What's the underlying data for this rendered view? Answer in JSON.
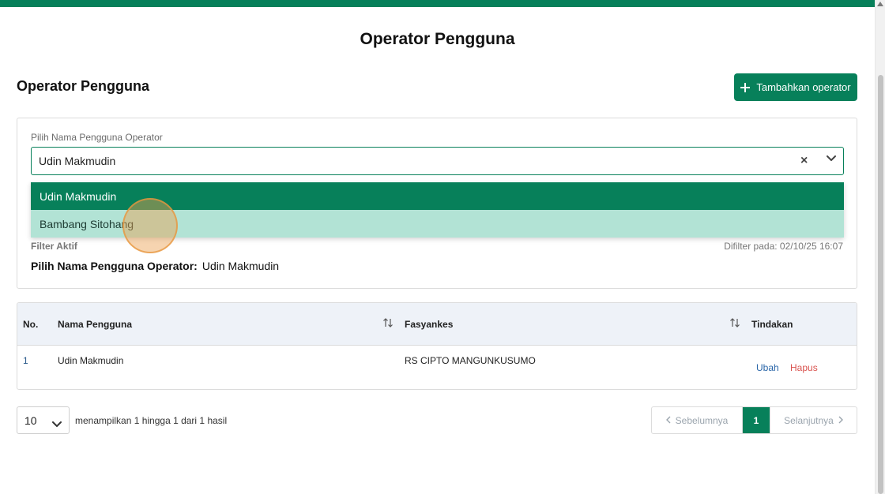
{
  "page": {
    "title": "Operator Pengguna"
  },
  "header": {
    "section_title": "Operator Pengguna",
    "add_button_label": "Tambahkan operator"
  },
  "filter": {
    "label": "Pilih Nama Pengguna Operator",
    "selected_value": "Udin Makmudin",
    "clear_symbol": "×",
    "options": [
      {
        "label": "Udin Makmudin",
        "state": "selected"
      },
      {
        "label": "Bambang Sitohang",
        "state": "hover"
      }
    ],
    "active_label": "Filter Aktif",
    "filtered_at": "Difilter pada: 02/10/25 16:07",
    "summary_key": "Pilih Nama Pengguna Operator:",
    "summary_value": "Udin Makmudin"
  },
  "table": {
    "headers": [
      "No.",
      "Nama Pengguna",
      "Fasyankes",
      "Tindakan"
    ],
    "rows": [
      {
        "no": "1",
        "name": "Udin Makmudin",
        "facility": "RS CIPTO MANGUNKUSUMO",
        "edit": "Ubah",
        "delete": "Hapus"
      }
    ]
  },
  "pagination": {
    "page_size": "10",
    "result_text": "menampilkan 1 hingga 1 dari 1 hasil",
    "prev_label": "Sebelumnya",
    "current_page": "1",
    "next_label": "Selanjutnya"
  },
  "colors": {
    "primary": "#07805a",
    "hover_option": "#b2e3d5",
    "delete_link": "#d9534f",
    "edit_link": "#2a66a8"
  },
  "icons": [
    "plus-icon",
    "clear-icon",
    "chevron-down-icon",
    "sort-icon",
    "chevron-left-icon",
    "chevron-right-icon"
  ]
}
